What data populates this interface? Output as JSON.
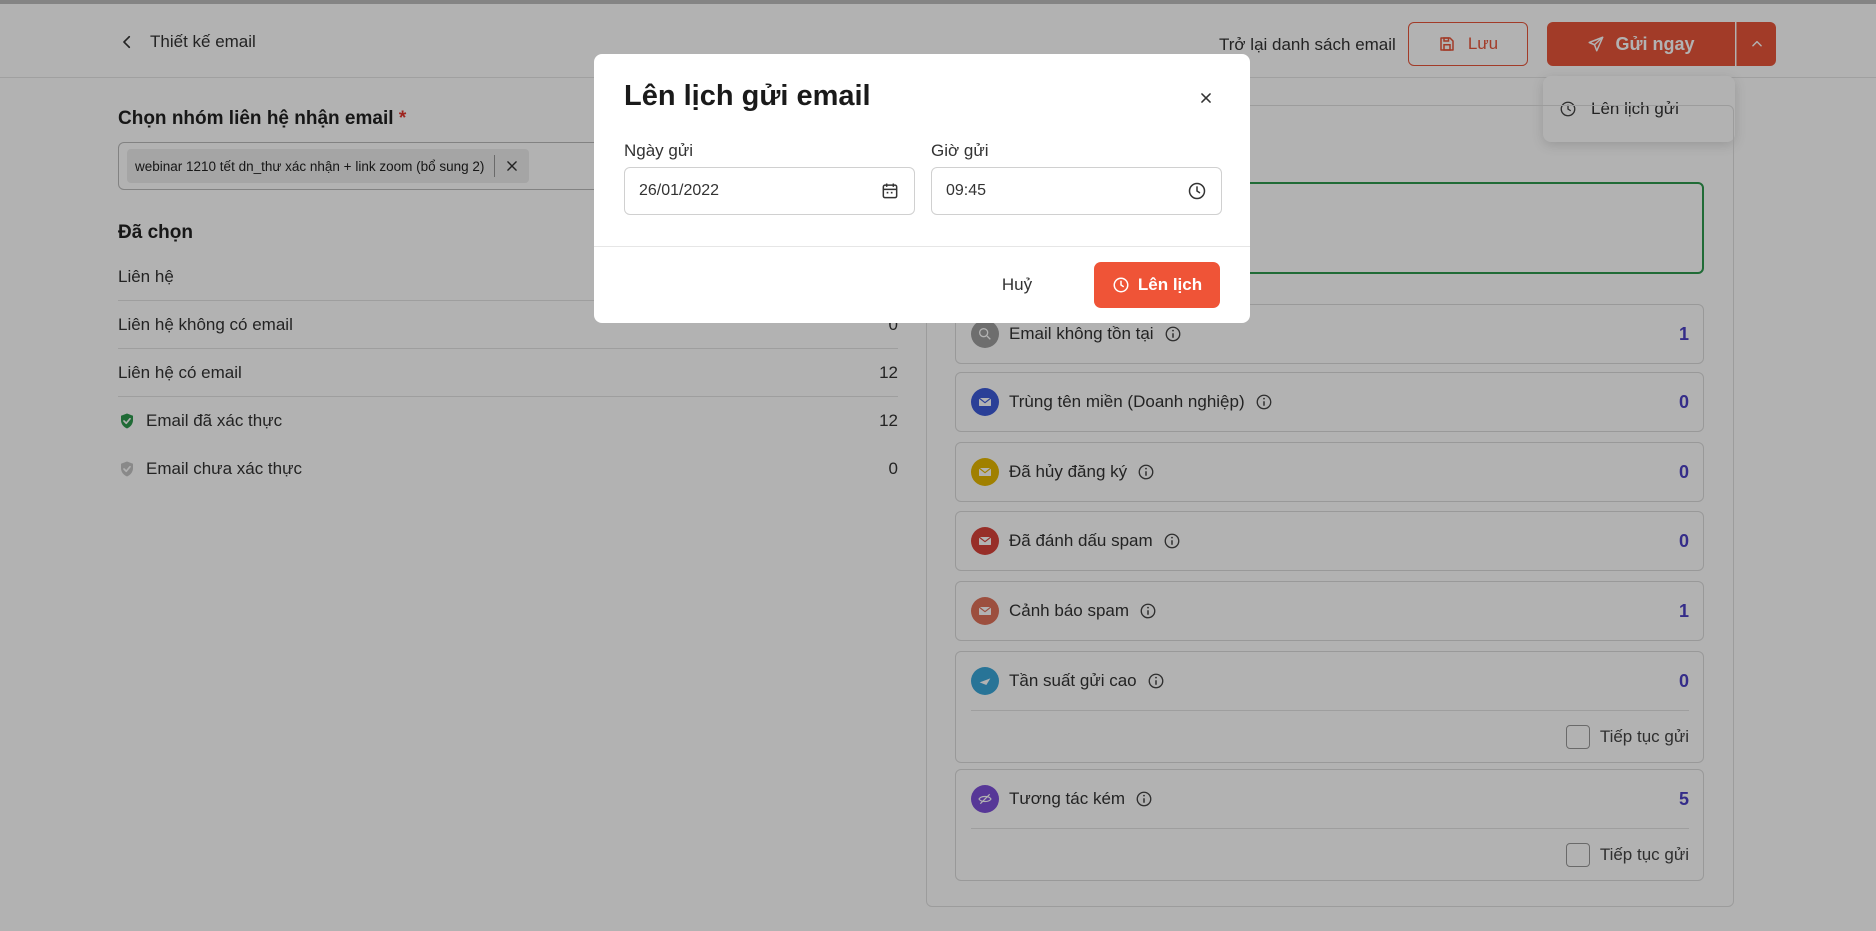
{
  "header": {
    "back_label": "Thiết kế email",
    "back_to_list": "Trở lại danh sách email",
    "save_label": "Lưu",
    "send_label": "Gửi ngay",
    "dropdown_item": "Lên lịch gửi"
  },
  "left": {
    "group_title": "Chọn nhóm liên hệ nhận email",
    "required_mark": "*",
    "selected_tag": "webinar 1210 tết dn_thư xác nhận + link zoom (bổ sung 2)",
    "selected_title": "Đã chọn",
    "stats": [
      {
        "label": "Liên hệ",
        "value": ""
      },
      {
        "label": "Liên hệ không có email",
        "value": "0"
      },
      {
        "label": "Liên hệ có email",
        "value": "12"
      },
      {
        "label": "Email đã xác thực",
        "value": "12"
      },
      {
        "label": "Email chưa xác thực",
        "value": "0"
      }
    ]
  },
  "right": {
    "cards": [
      {
        "label": "Email không tồn tại",
        "value": "1",
        "color": "#9e9e9e"
      },
      {
        "label": "Trùng tên miền (Doanh nghiệp)",
        "value": "0",
        "color": "#3d5bd9"
      },
      {
        "label": "Đã hủy đăng ký",
        "value": "0",
        "color": "#e6b800"
      },
      {
        "label": "Đã đánh dấu spam",
        "value": "0",
        "color": "#d9423a"
      },
      {
        "label": "Cảnh báo spam",
        "value": "1",
        "color": "#e0715a"
      },
      {
        "label": "Tần suất gửi cao",
        "value": "0",
        "color": "#3aa6d9",
        "continue_label": "Tiếp tục gửi"
      },
      {
        "label": "Tương tác kém",
        "value": "5",
        "color": "#7d4fd9",
        "continue_label": "Tiếp tục gửi"
      }
    ]
  },
  "modal": {
    "title": "Lên lịch gửi email",
    "date_label": "Ngày gửi",
    "date_value": "26/01/2022",
    "time_label": "Giờ gửi",
    "time_value": "09:45",
    "cancel_label": "Huỷ",
    "schedule_label": "Lên lịch"
  }
}
